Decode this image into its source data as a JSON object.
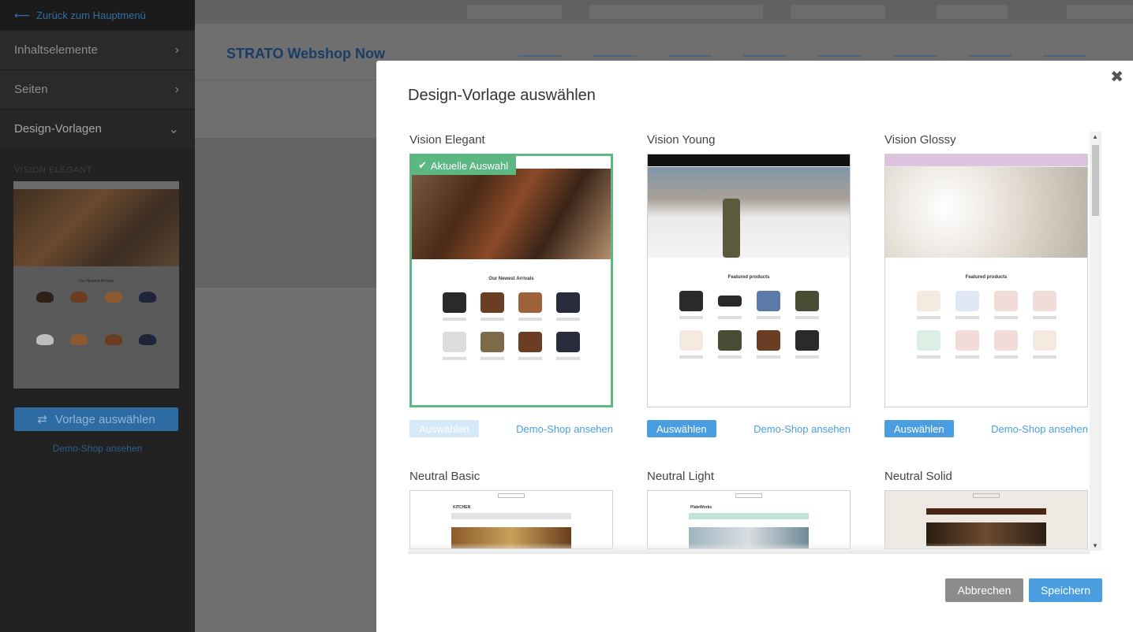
{
  "sidebar": {
    "back_label": "Zurück zum Hauptmenü",
    "items": [
      {
        "label": "Inhaltselemente"
      },
      {
        "label": "Seiten"
      },
      {
        "label": "Design-Vorlagen"
      }
    ],
    "current_template_label": "VISION ELEGANT",
    "thumb_section_title": "Our Newest Arrivals",
    "choose_button": "Vorlage auswählen",
    "demo_link": "Demo-Shop ansehen"
  },
  "editor": {
    "brand": "STRATO Webshop Now"
  },
  "modal": {
    "title": "Design-Vorlage auswählen",
    "selected_badge": "Aktuelle Auswahl",
    "select_label": "Auswählen",
    "demo_label": "Demo-Shop ansehen",
    "cancel_label": "Abbrechen",
    "save_label": "Speichern",
    "templates": [
      {
        "name": "Vision Elegant",
        "section_title": "Our Newest Arrivals"
      },
      {
        "name": "Vision Young",
        "section_title": "Featured products"
      },
      {
        "name": "Vision Glossy",
        "section_title": "Featured products"
      },
      {
        "name": "Neutral Basic",
        "logo": "KITCHEN"
      },
      {
        "name": "Neutral Light",
        "logo": "PlateWorks"
      },
      {
        "name": "Neutral Solid",
        "logo": ""
      }
    ]
  },
  "colors": {
    "accent": "#4a9ee0",
    "selected": "#5cb783",
    "sidebar_bg": "#222222"
  }
}
